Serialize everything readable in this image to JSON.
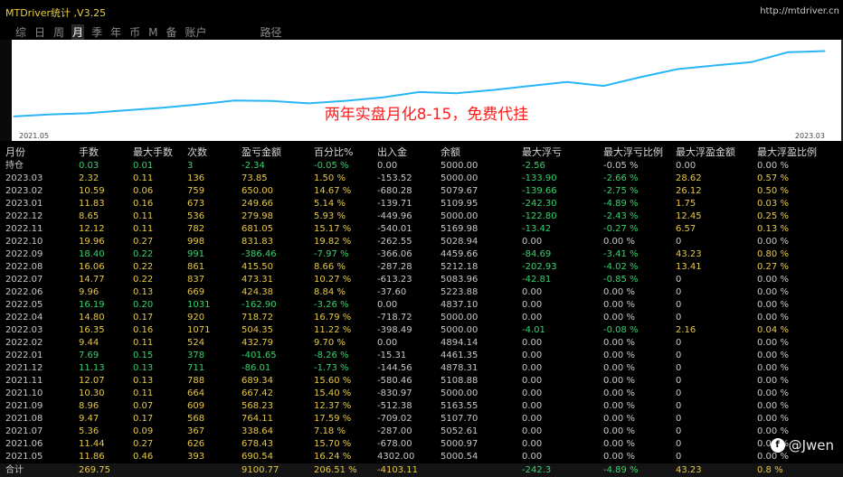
{
  "app": {
    "title": "MTDriver统计 ,V3.25",
    "url": "http://mtdriver.cn"
  },
  "tabs": [
    {
      "label": "综",
      "active": false
    },
    {
      "label": "日",
      "active": false
    },
    {
      "label": "周",
      "active": false
    },
    {
      "label": "月",
      "active": true
    },
    {
      "label": "季",
      "active": false
    },
    {
      "label": "年",
      "active": false
    },
    {
      "label": "币",
      "active": false
    },
    {
      "label": "M",
      "active": false
    },
    {
      "label": "备",
      "active": false
    },
    {
      "label": "账户",
      "active": false
    },
    {
      "label": "路径",
      "active": false
    }
  ],
  "chart": {
    "overlay_text": "两年实盘月化8-15，免费代挂",
    "axis_start": "2021.05",
    "axis_end": "2023.03",
    "line_color": "#29b6f6",
    "chart_data": {
      "type": "line",
      "categories": [
        "2021.05",
        "2021.06",
        "2021.07",
        "2021.08",
        "2021.09",
        "2021.10",
        "2021.11",
        "2021.12",
        "2022.01",
        "2022.02",
        "2022.03",
        "2022.04",
        "2022.05",
        "2022.06",
        "2022.07",
        "2022.08",
        "2022.09",
        "2022.10",
        "2022.11",
        "2022.12",
        "2023.01",
        "2023.02",
        "2023.03"
      ],
      "values": [
        100.0,
        115.7,
        123.2,
        144.9,
        163.0,
        188.1,
        217.4,
        213.7,
        196.1,
        215.1,
        239.3,
        279.5,
        270.4,
        294.3,
        324.5,
        352.6,
        324.5,
        388.8,
        447.8,
        474.4,
        499.1,
        571.9,
        580.5
      ],
      "ylim": [
        0,
        650
      ]
    }
  },
  "table": {
    "columns": [
      "月份",
      "手数",
      "最大手数",
      "次数",
      "盈亏金额",
      "百分比%",
      "出入金",
      "余额",
      "最大浮亏",
      "最大浮亏比例",
      "最大浮盈金额",
      "最大浮盈比例"
    ],
    "hold": [
      "持仓",
      "0.03",
      "0.01",
      "3",
      "-2.34",
      "-0.05 %",
      "0.00",
      "5000.00",
      "-2.56",
      "-0.05 %",
      "0.00",
      "0.00 %"
    ],
    "rows": [
      [
        "2023.03",
        "2.32",
        "0.11",
        "136",
        "73.85",
        "1.50 %",
        "-153.52",
        "5000.00",
        "-133.90",
        "-2.66 %",
        "28.62",
        "0.57 %"
      ],
      [
        "2023.02",
        "10.59",
        "0.06",
        "759",
        "650.00",
        "14.67 %",
        "-680.28",
        "5079.67",
        "-139.66",
        "-2.75 %",
        "26.12",
        "0.50 %"
      ],
      [
        "2023.01",
        "11.83",
        "0.16",
        "673",
        "249.66",
        "5.14 %",
        "-139.71",
        "5109.95",
        "-242.30",
        "-4.89 %",
        "1.75",
        "0.03 %"
      ],
      [
        "2022.12",
        "8.65",
        "0.11",
        "536",
        "279.98",
        "5.93 %",
        "-449.96",
        "5000.00",
        "-122.80",
        "-2.43 %",
        "12.45",
        "0.25 %"
      ],
      [
        "2022.11",
        "12.12",
        "0.11",
        "782",
        "681.05",
        "15.17 %",
        "-540.01",
        "5169.98",
        "-13.42",
        "-0.27 %",
        "6.57",
        "0.13 %"
      ],
      [
        "2022.10",
        "19.96",
        "0.27",
        "998",
        "831.83",
        "19.82 %",
        "-262.55",
        "5028.94",
        "0.00",
        "0.00 %",
        "0",
        "0.00 %"
      ],
      [
        "2022.09",
        "18.40",
        "0.22",
        "991",
        "-386.46",
        "-7.97 %",
        "-366.06",
        "4459.66",
        "-84.69",
        "-3.41 %",
        "43.23",
        "0.80 %"
      ],
      [
        "2022.08",
        "16.06",
        "0.22",
        "861",
        "415.50",
        "8.66 %",
        "-287.28",
        "5212.18",
        "-202.93",
        "-4.02 %",
        "13.41",
        "0.27 %"
      ],
      [
        "2022.07",
        "14.77",
        "0.22",
        "837",
        "473.31",
        "10.27 %",
        "-613.23",
        "5083.96",
        "-42.81",
        "-0.85 %",
        "0",
        "0.00 %"
      ],
      [
        "2022.06",
        "9.96",
        "0.13",
        "669",
        "424.38",
        "8.84 %",
        "-37.60",
        "5223.88",
        "0.00",
        "0.00 %",
        "0",
        "0.00 %"
      ],
      [
        "2022.05",
        "16.19",
        "0.20",
        "1031",
        "-162.90",
        "-3.26 %",
        "0.00",
        "4837.10",
        "0.00",
        "0.00 %",
        "0",
        "0.00 %"
      ],
      [
        "2022.04",
        "14.80",
        "0.17",
        "920",
        "718.72",
        "16.79 %",
        "-718.72",
        "5000.00",
        "0.00",
        "0.00 %",
        "0",
        "0.00 %"
      ],
      [
        "2022.03",
        "16.35",
        "0.16",
        "1071",
        "504.35",
        "11.22 %",
        "-398.49",
        "5000.00",
        "-4.01",
        "-0.08 %",
        "2.16",
        "0.04 %"
      ],
      [
        "2022.02",
        "9.44",
        "0.11",
        "524",
        "432.79",
        "9.70 %",
        "0.00",
        "4894.14",
        "0.00",
        "0.00 %",
        "0",
        "0.00 %"
      ],
      [
        "2022.01",
        "7.69",
        "0.15",
        "378",
        "-401.65",
        "-8.26 %",
        "-15.31",
        "4461.35",
        "0.00",
        "0.00 %",
        "0",
        "0.00 %"
      ],
      [
        "2021.12",
        "11.13",
        "0.13",
        "711",
        "-86.01",
        "-1.73 %",
        "-144.56",
        "4878.31",
        "0.00",
        "0.00 %",
        "0",
        "0.00 %"
      ],
      [
        "2021.11",
        "12.07",
        "0.13",
        "788",
        "689.34",
        "15.60 %",
        "-580.46",
        "5108.88",
        "0.00",
        "0.00 %",
        "0",
        "0.00 %"
      ],
      [
        "2021.10",
        "10.30",
        "0.11",
        "664",
        "667.42",
        "15.40 %",
        "-830.97",
        "5000.00",
        "0.00",
        "0.00 %",
        "0",
        "0.00 %"
      ],
      [
        "2021.09",
        "8.96",
        "0.07",
        "609",
        "568.23",
        "12.37 %",
        "-512.38",
        "5163.55",
        "0.00",
        "0.00 %",
        "0",
        "0.00 %"
      ],
      [
        "2021.08",
        "9.47",
        "0.17",
        "568",
        "764.11",
        "17.59 %",
        "-709.02",
        "5107.70",
        "0.00",
        "0.00 %",
        "0",
        "0.00 %"
      ],
      [
        "2021.07",
        "5.36",
        "0.09",
        "367",
        "338.64",
        "7.18 %",
        "-287.00",
        "5052.61",
        "0.00",
        "0.00 %",
        "0",
        "0.00 %"
      ],
      [
        "2021.06",
        "11.44",
        "0.27",
        "626",
        "678.43",
        "15.70 %",
        "-678.00",
        "5000.97",
        "0.00",
        "0.00 %",
        "0",
        "0.00 %"
      ],
      [
        "2021.05",
        "11.86",
        "0.46",
        "393",
        "690.54",
        "16.24 %",
        "4302.00",
        "5000.54",
        "0.00",
        "0.00 %",
        "0",
        "0.00 %"
      ]
    ],
    "footer": [
      "合计",
      "269.75",
      "",
      "",
      "9100.77",
      "206.51 %",
      "-4103.11",
      "",
      "-242.3",
      "-4.89 %",
      "43.23",
      "0.8 %"
    ]
  },
  "watermark": {
    "icon_text": "f",
    "text": "@Jwen"
  },
  "colors": {
    "positive": "#36d36c",
    "neutral": "#e6c84a",
    "title": "#e8d040"
  }
}
